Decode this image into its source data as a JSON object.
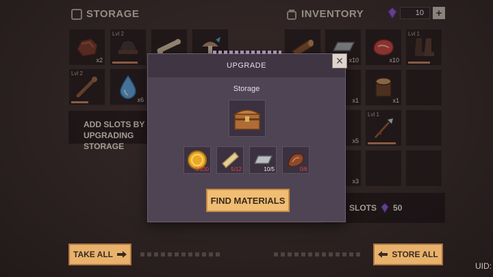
{
  "storage": {
    "title": "STORAGE",
    "slots": [
      {
        "level": "",
        "qty": "x2"
      },
      {
        "level": "Lvl 2",
        "qty": ""
      },
      {
        "level": "",
        "qty": ""
      },
      {
        "level": "",
        "qty": ""
      },
      {
        "level": "Lvl 2",
        "qty": ""
      },
      {
        "level": "",
        "qty": "x6"
      }
    ],
    "banner": "ADD SLOTS BY UPGRADING STORAGE",
    "take_all": "TAKE ALL"
  },
  "inventory": {
    "title": "INVENTORY",
    "gems": "10",
    "slots": [
      {
        "level": "",
        "qty": ""
      },
      {
        "level": "",
        "qty": "x10"
      },
      {
        "level": "",
        "qty": "x10"
      },
      {
        "level": "Lvl 1",
        "qty": ""
      },
      {
        "level": "",
        "qty": "x1"
      },
      {
        "level": "",
        "qty": "x1"
      },
      {
        "level": "",
        "qty": "x5"
      },
      {
        "level": "Lvl 1",
        "qty": ""
      },
      {
        "level": "",
        "qty": "x3"
      }
    ],
    "add_slots": "SLOTS",
    "add_slots_cost": "50",
    "store_all": "STORE ALL"
  },
  "modal": {
    "title": "UPGRADE",
    "subtitle": "Storage",
    "materials": [
      {
        "icon": "coin-icon",
        "count": "5/100",
        "enough": false
      },
      {
        "icon": "wood-plank-icon",
        "count": "5/12",
        "enough": false
      },
      {
        "icon": "iron-ingot-icon",
        "count": "10/5",
        "enough": true
      },
      {
        "icon": "leather-icon",
        "count": "0/6",
        "enough": false
      }
    ],
    "find_button": "FIND MATERIALS",
    "close": "×"
  },
  "footer": {
    "uid_label": "UID:"
  },
  "colors": {
    "accent_orange": "#f0bd73",
    "missing_red": "#e2483e",
    "gem_purple": "#8a5ad1",
    "modal_bg": "#4f4453"
  }
}
